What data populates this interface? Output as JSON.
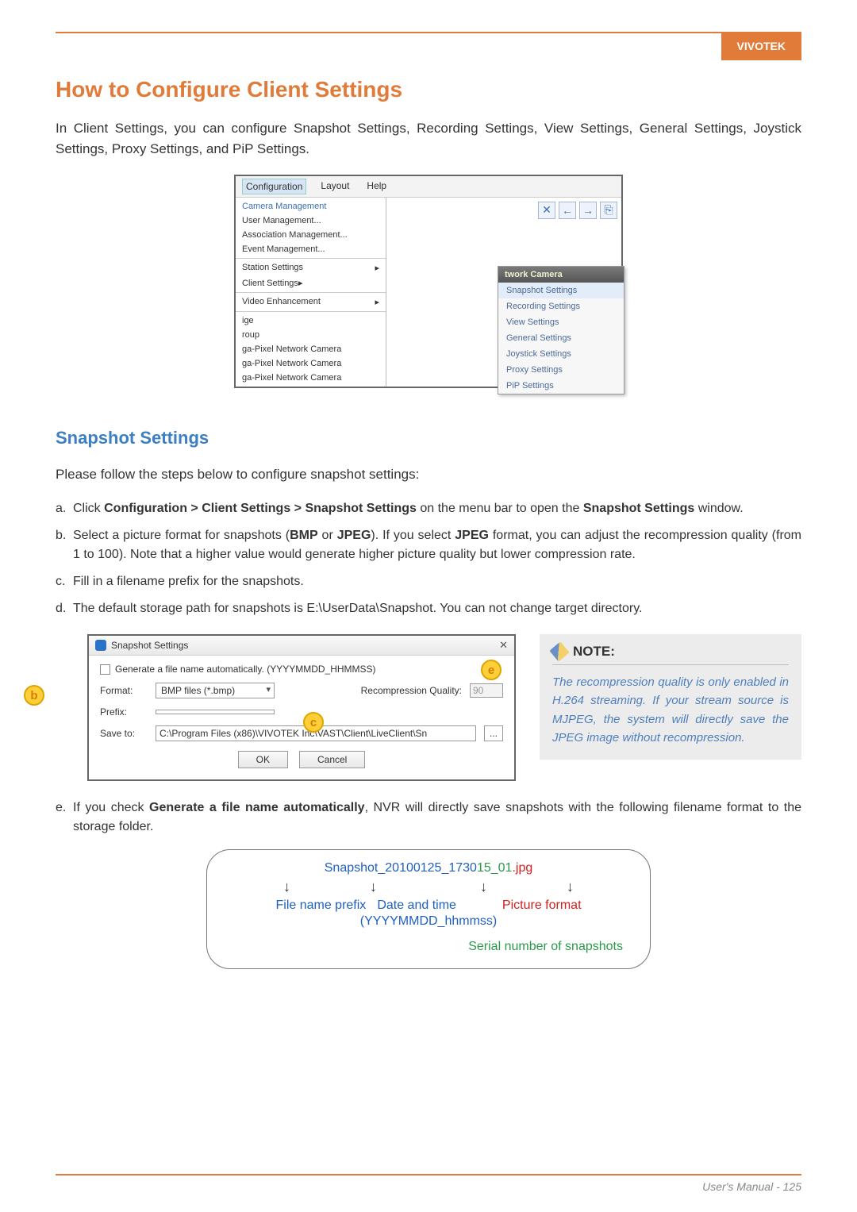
{
  "brand": "VIVOTEK",
  "h1": "How to Configure Client Settings",
  "intro": "In Client Settings, you can configure Snapshot Settings, Recording Settings, View Settings, General Settings, Joystick Settings, Proxy Settings, and PiP Settings.",
  "menubar": {
    "configuration": "Configuration",
    "layout": "Layout",
    "help": "Help"
  },
  "config_menu": {
    "camera_mgmt": "Camera Management",
    "user_mgmt": "User Management...",
    "assoc_mgmt": "Association Management...",
    "event_mgmt": "Event Management...",
    "station": "Station Settings",
    "client": "Client Settings",
    "video_enh": "Video Enhancement",
    "tree_frag1": "ige",
    "tree_frag2": "roup",
    "tree_cam1": "ga-Pixel Network Camera",
    "tree_cam2": "ga-Pixel Network Camera",
    "tree_cam3": "ga-Pixel Network Camera"
  },
  "submenu": {
    "title": "twork Camera",
    "items": [
      "Snapshot Settings",
      "Recording Settings",
      "View Settings",
      "General Settings",
      "Joystick Settings",
      "Proxy Settings",
      "PiP Settings"
    ]
  },
  "h2": "Snapshot Settings",
  "p2": "Please follow the steps below to configure snapshot settings:",
  "steps": {
    "a_pre": "Click ",
    "a_bold1": "Configuration > Client Settings > Snapshot Settings",
    "a_mid": " on the menu bar to open the ",
    "a_bold2": "Snapshot Settings",
    "a_post": " window.",
    "b_pre": "Select a picture format for snapshots (",
    "b_b1": "BMP",
    "b_or": " or ",
    "b_b2": "JPEG",
    "b_mid": "). If you select ",
    "b_b3": "JPEG",
    "b_post": " format, you can adjust the recompression quality (from 1 to 100). Note that a higher value would generate higher picture quality but lower compression rate.",
    "c": "Fill in a filename prefix for the snapshots.",
    "d": "The default storage path for snapshots is E:\\UserData\\Snapshot. You can not change target directory.",
    "e_pre": "If you check ",
    "e_bold": "Generate a file name automatically",
    "e_post": ", NVR will directly save snapshots with the following filename format to the storage folder."
  },
  "snapshot_win": {
    "title": "Snapshot Settings",
    "checkbox_label": "Generate a file name automatically. (YYYYMMDD_HHMMSS)",
    "format_label": "Format:",
    "format_value": "BMP files (*.bmp)",
    "quality_label": "Recompression Quality:",
    "quality_value": "90",
    "prefix_label": "Prefix:",
    "save_label": "Save to:",
    "save_value": "C:\\Program Files (x86)\\VIVOTEK Inc\\VAST\\Client\\LiveClient\\Sn",
    "browse": "...",
    "ok": "OK",
    "cancel": "Cancel"
  },
  "badges": {
    "b": "b",
    "c": "c",
    "e": "e"
  },
  "note": {
    "heading": "NOTE:",
    "text": "The recompression quality is only enabled in H.264 streaming. If your stream source is MJPEG, the system will directly save the JPEG image without recompression."
  },
  "diagram": {
    "fname_prefix": "Snapshot_",
    "fname_dtpart": "20100125_1730",
    "fname_ss": "15",
    "fname_serial": "_01",
    "fname_ext": ".jpg",
    "leg_prefix": "File name prefix",
    "leg_dt": "Date and time",
    "leg_fmt": "Picture format",
    "leg_dt_sub": "(YYYYMMDD_hhmmss)",
    "serial": "Serial number of snapshots"
  },
  "footer": "User's Manual - 125"
}
